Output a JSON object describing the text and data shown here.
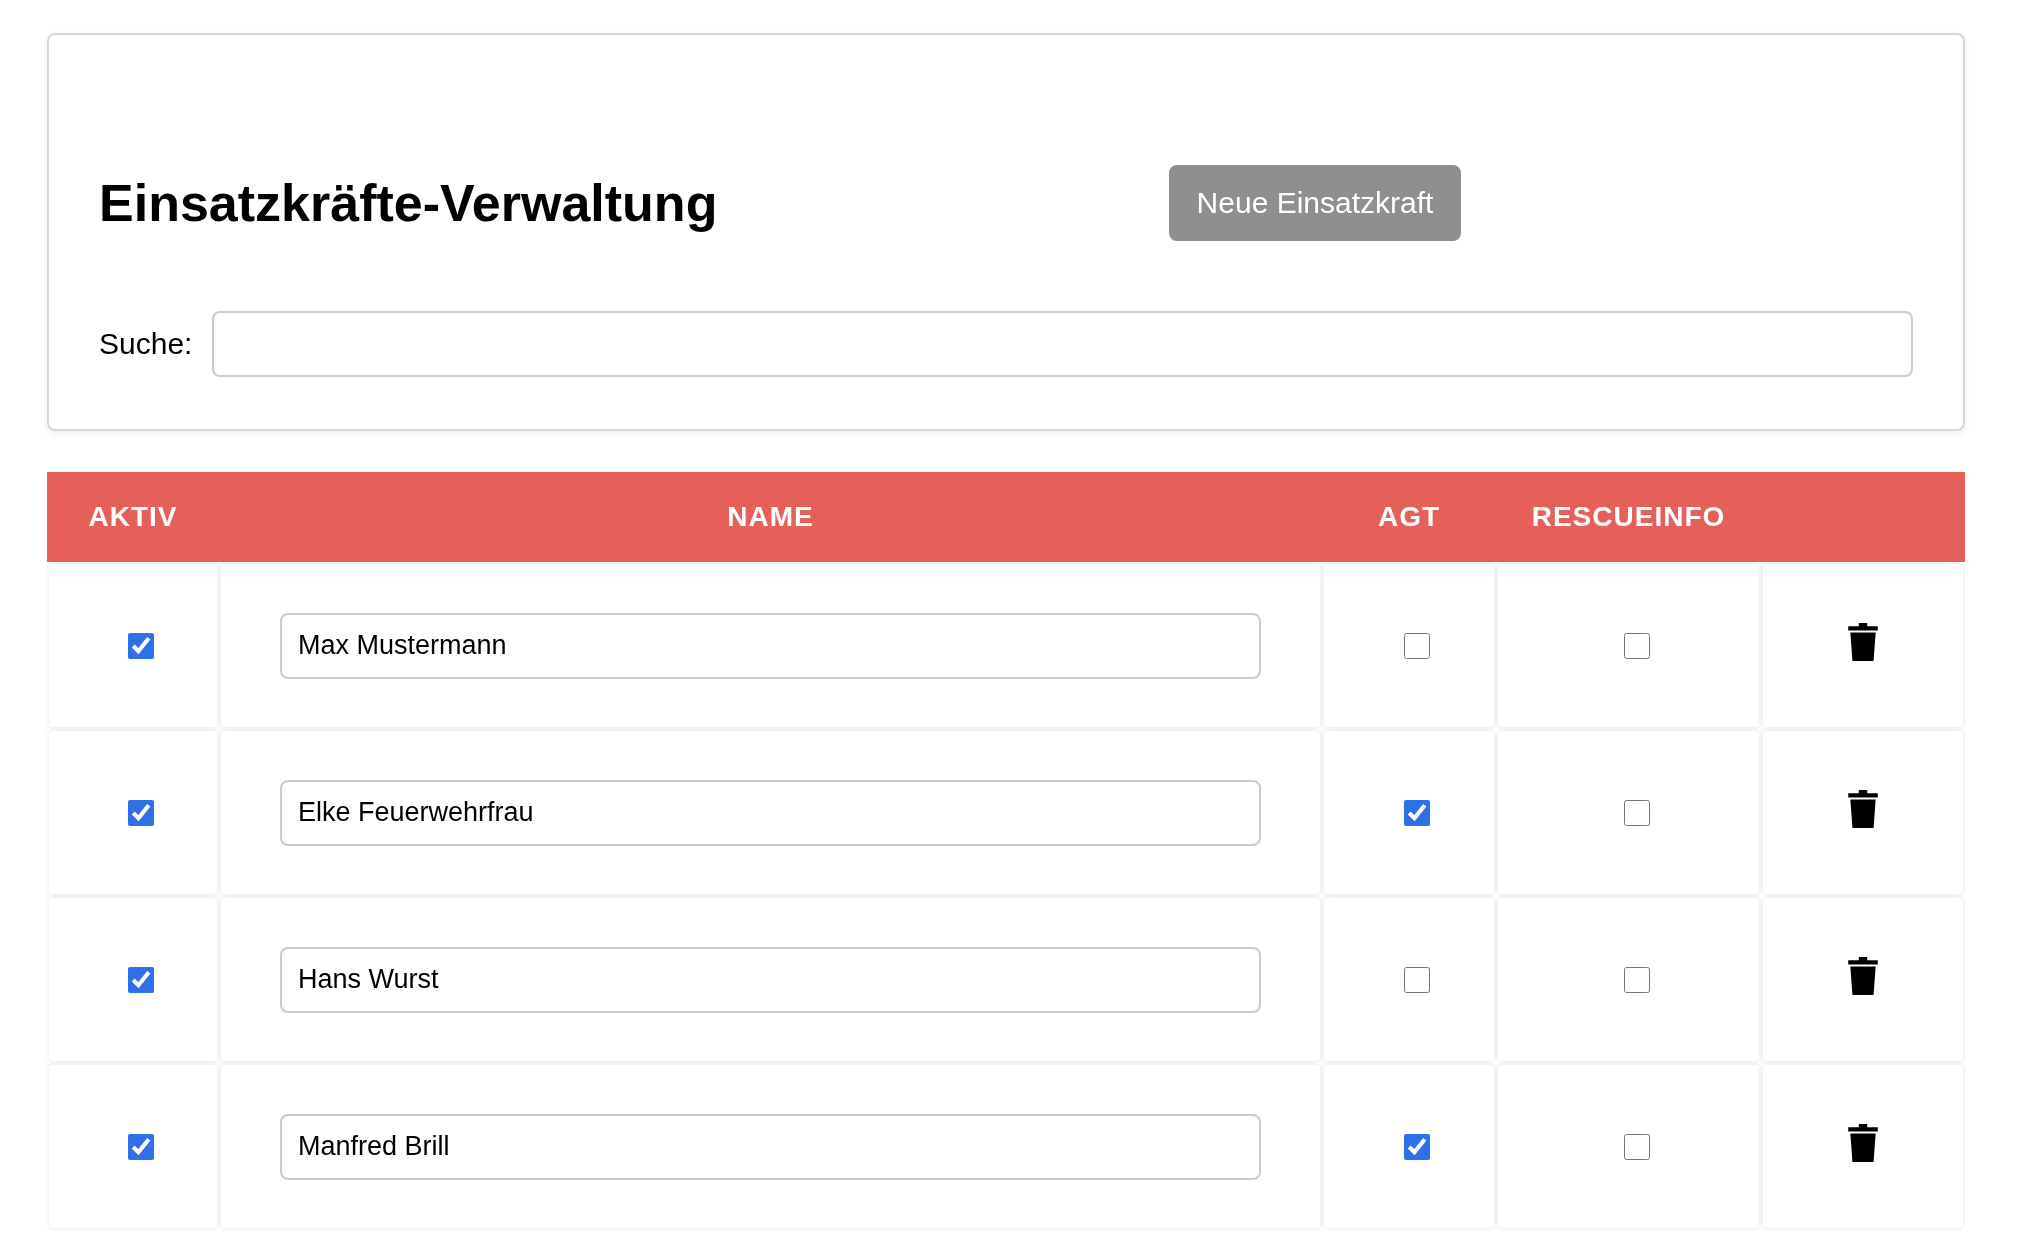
{
  "title": "Einsatzkräfte-Verwaltung",
  "new_button": "Neue Einsatzkraft",
  "search": {
    "label": "Suche:"
  },
  "table": {
    "columns": [
      "AKTIV",
      "NAME",
      "AGT",
      "RESCUEINFO"
    ],
    "rows": [
      {
        "active": true,
        "name": "Max Mustermann",
        "agt": false,
        "rescueinfo": false
      },
      {
        "active": true,
        "name": "Elke Feuerwehrfrau",
        "agt": true,
        "rescueinfo": false
      },
      {
        "active": true,
        "name": "Hans Wurst",
        "agt": false,
        "rescueinfo": false
      },
      {
        "active": true,
        "name": "Manfred Brill",
        "agt": true,
        "rescueinfo": false
      }
    ]
  }
}
